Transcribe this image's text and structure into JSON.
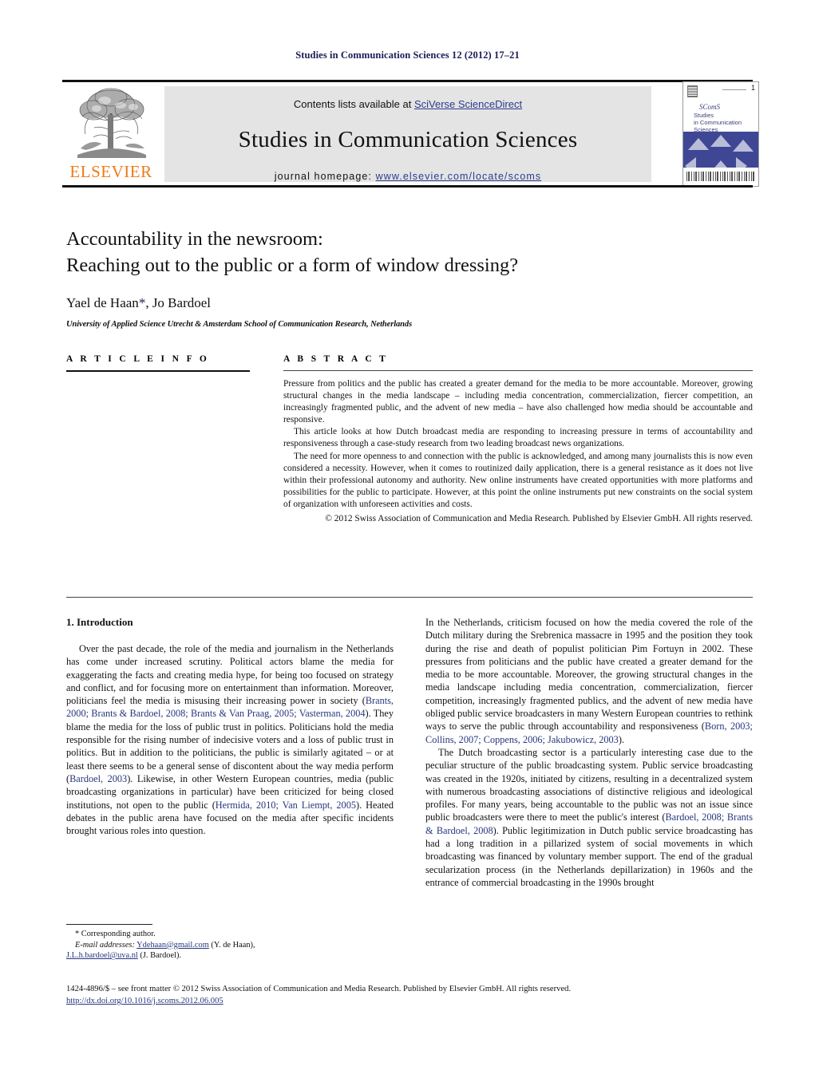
{
  "running_head": "Studies in Communication Sciences 12 (2012) 17–21",
  "masthead": {
    "contents_prefix": "Contents lists available at ",
    "sciencedirect": "SciVerse ScienceDirect",
    "journal_name": "Studies in Communication Sciences",
    "homepage_prefix": "journal homepage: ",
    "homepage_url": "www.elsevier.com/locate/scoms",
    "elsevier_wordmark": "ELSEVIER",
    "accent_link_color": "#2b3b8f",
    "elsevier_orange": "#ee7b17",
    "panel_grey": "#e4e4e4"
  },
  "cover": {
    "issue_number": "1",
    "scoms": "SComS",
    "title_line1": "Studies",
    "title_line2": "in Communication",
    "title_line3": "Sciences",
    "blue": "#3f4795"
  },
  "title_block": {
    "title_line1": "Accountability in the newsroom:",
    "title_line2": "Reaching out to the public or a form of window dressing?",
    "authors": "Yael de Haan",
    "authors_star": "*",
    "authors_rest": ", Jo Bardoel",
    "affiliation": "University of Applied Science Utrecht & Amsterdam School of Communication Research, Netherlands"
  },
  "article_info": {
    "heading": "A R T I C L E  I N F O"
  },
  "abstract": {
    "heading": "A B S T R A C T",
    "paragraphs": [
      "Pressure from politics and the public has created a greater demand for the media to be more accountable. Moreover, growing structural changes in the media landscape – including media concentration, commercialization, fiercer competition, an increasingly fragmented public, and the advent of new media – have also challenged how media should be accountable and responsive.",
      "This article looks at how Dutch broadcast media are responding to increasing pressure in terms of accountability and responsiveness through a case-study research from two leading broadcast news organizations.",
      "The need for more openness to and connection with the public is acknowledged, and among many journalists this is now even considered a necessity. However, when it comes to routinized daily application, there is a general resistance as it does not live within their professional autonomy and authority. New online instruments have created opportunities with more platforms and possibilities for the public to participate. However, at this point the online instruments put new constraints on the social system of organization with unforeseen activities and costs."
    ],
    "copyright": "© 2012 Swiss Association of Communication and Media Research. Published by Elsevier GmbH. All rights reserved."
  },
  "body": {
    "section_heading": "1.  Introduction",
    "left_paragraphs": [
      {
        "segments": [
          {
            "t": "Over the past decade, the role of the media and journalism in the Netherlands has come under increased scrutiny. Political actors blame the media for exaggerating the facts and creating media hype, for being too focused on strategy and conflict, and for focusing more on entertainment than information. Moreover, politicians feel the media is misusing their increasing power in society ("
          },
          {
            "t": "Brants, 2000; Brants & Bardoel, 2008; Brants & Van Praag, 2005; Vasterman, 2004",
            "ref": true
          },
          {
            "t": "). They blame the media for the loss of public trust in politics. Politicians hold the media responsible for the rising number of indecisive voters and a loss of public trust in politics. But in addition to the politicians, the public is similarly agitated – or at least there seems to be a general sense of discontent about the way media perform ("
          },
          {
            "t": "Bardoel, 2003",
            "ref": true
          },
          {
            "t": "). Likewise, in other Western European countries, media (public broadcasting organizations in particular) have been criticized for being closed institutions, not open to the public ("
          },
          {
            "t": "Hermida, 2010; Van Liempt, 2005",
            "ref": true
          },
          {
            "t": "). Heated debates in the public arena have focused on the media after specific incidents brought various roles into question."
          }
        ]
      }
    ],
    "right_paragraphs": [
      {
        "segments": [
          {
            "t": "In the Netherlands, criticism focused on how the media covered the role of the Dutch military during the Srebrenica massacre in 1995 and the position they took during the rise and death of populist politician Pim Fortuyn in 2002. These pressures from politicians and the public have created a greater demand for the media to be more accountable. Moreover, the growing structural changes in the media landscape including media concentration, commercialization, fiercer competition, increasingly fragmented publics, and the advent of new media have obliged public service broadcasters in many Western European countries to rethink ways to serve the public through accountability and responsiveness ("
          },
          {
            "t": "Born, 2003; Collins, 2007; Coppens, 2006; Jakubowicz, 2003",
            "ref": true
          },
          {
            "t": ")."
          }
        ]
      },
      {
        "segments": [
          {
            "t": "The Dutch broadcasting sector is a particularly interesting case due to the peculiar structure of the public broadcasting system. Public service broadcasting was created in the 1920s, initiated by citizens, resulting in a decentralized system with numerous broadcasting associations of distinctive religious and ideological profiles. For many years, being accountable to the public was not an issue since public broadcasters were there to meet the public's interest ("
          },
          {
            "t": "Bardoel, 2008; Brants & Bardoel, 2008",
            "ref": true
          },
          {
            "t": "). Public legitimization in Dutch public service broadcasting has had a long tradition in a pillarized system of social movements in which broadcasting was financed by voluntary member support. The end of the gradual secularization process (in the Netherlands depillarization) in 1960s and the entrance of commercial broadcasting in the 1990s brought"
          }
        ]
      }
    ]
  },
  "footnote": {
    "corresponding": "*  Corresponding author.",
    "email_label": "E-mail addresses:",
    "email1": "Ydehaan@gmail.com",
    "email1_owner": " (Y. de Haan),",
    "email2": "J.L.h.bardoel@uva.nl",
    "email2_owner": " (J. Bardoel)."
  },
  "footer": {
    "line1": "1424-4896/$ – see front matter © 2012 Swiss Association of Communication and Media Research. Published by Elsevier GmbH. All rights reserved.",
    "doi": "http://dx.doi.org/10.1016/j.scoms.2012.06.005"
  }
}
